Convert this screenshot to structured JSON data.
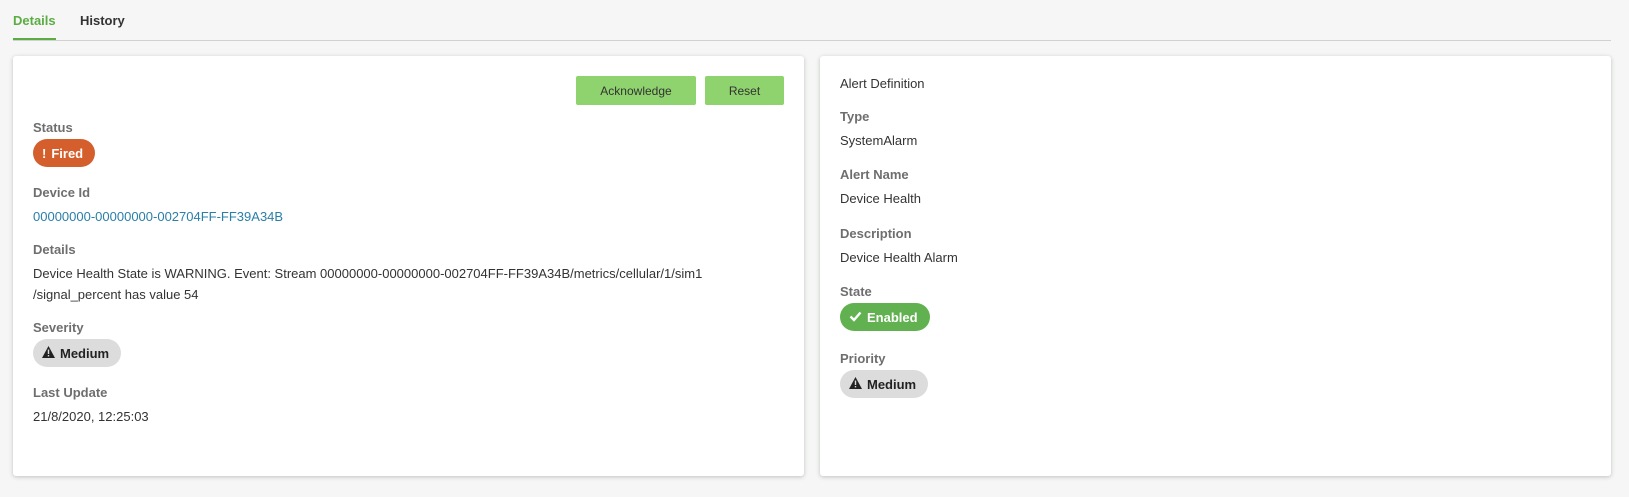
{
  "tabs": [
    {
      "label": "Details",
      "active": true
    },
    {
      "label": "History",
      "active": false
    }
  ],
  "actions": {
    "acknowledge_label": "Acknowledge",
    "reset_label": "Reset"
  },
  "alert": {
    "status_label": "Status",
    "status_value": "Fired",
    "status_icon": "exclamation-icon",
    "device_id_label": "Device Id",
    "device_id_value": "00000000-00000000-002704FF-FF39A34B",
    "details_label": "Details",
    "details_line1": "Device Health State is WARNING. Event: Stream 00000000-00000000-002704FF-FF39A34B/metrics/cellular/1/sim1",
    "details_line2": "/signal_percent has value 54",
    "severity_label": "Severity",
    "severity_value": "Medium",
    "severity_icon": "warning-icon",
    "last_update_label": "Last Update",
    "last_update_value": "21/8/2020, 12:25:03"
  },
  "definition": {
    "title": "Alert Definition",
    "type_label": "Type",
    "type_value": "SystemAlarm",
    "alert_name_label": "Alert Name",
    "alert_name_value": "Device Health",
    "description_label": "Description",
    "description_value": "Device Health Alarm",
    "state_label": "State",
    "state_value": "Enabled",
    "state_icon": "check-icon",
    "priority_label": "Priority",
    "priority_value": "Medium",
    "priority_icon": "warning-icon"
  },
  "colors": {
    "accent": "#5cac44",
    "button": "#8fd36e",
    "fired": "#d45f2c",
    "enabled": "#62b150",
    "neutral_badge": "#dcdcdc",
    "link": "#2a7fa8"
  }
}
